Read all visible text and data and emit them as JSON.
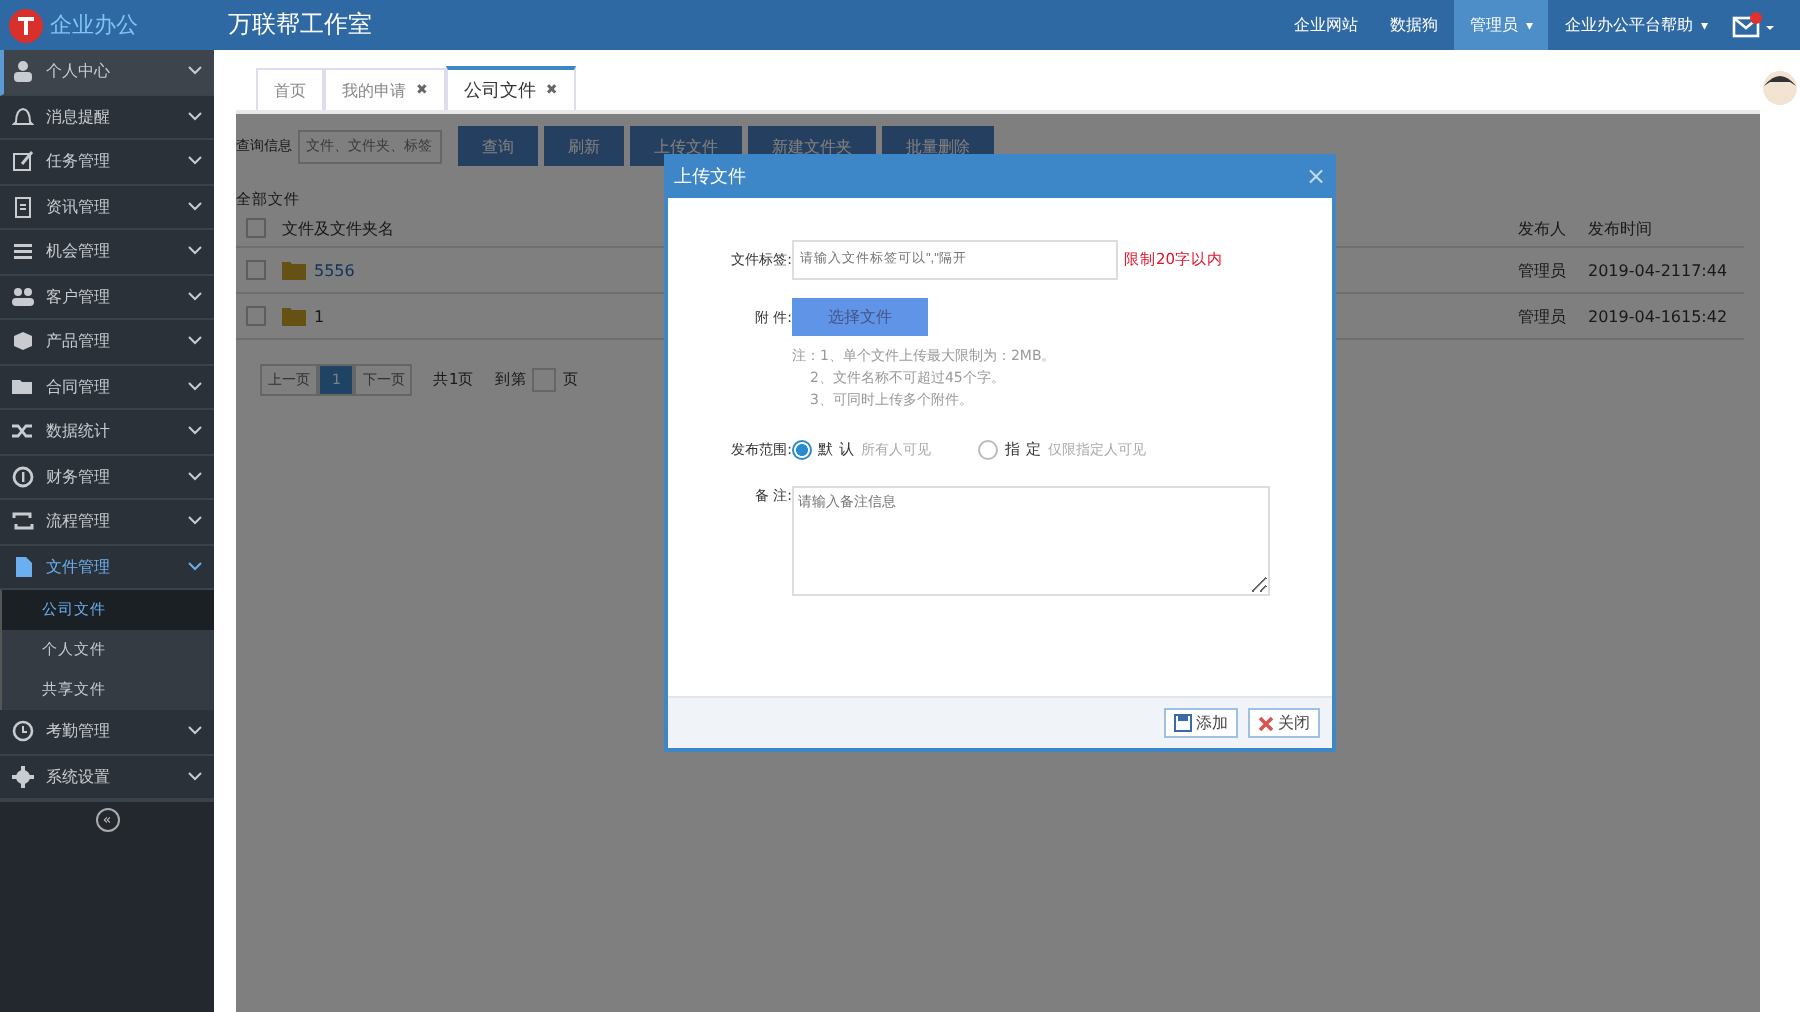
{
  "header": {
    "logo_text": "企业办公",
    "title": "万联帮工作室",
    "links": [
      {
        "label": "企业网站",
        "selected": false
      },
      {
        "label": "数据狗",
        "selected": false
      },
      {
        "label": "管理员",
        "selected": true,
        "caret": "▾"
      },
      {
        "label": "企业办公平台帮助",
        "selected": false,
        "caret": "▾"
      }
    ]
  },
  "sidebar": {
    "items": [
      {
        "label": "个人中心",
        "selected": true,
        "expanded": false
      },
      {
        "label": "消息提醒",
        "selected": false,
        "expanded": false
      },
      {
        "label": "任务管理",
        "selected": false,
        "expanded": false
      },
      {
        "label": "资讯管理",
        "selected": false,
        "expanded": false
      },
      {
        "label": "机会管理",
        "selected": false,
        "expanded": false
      },
      {
        "label": "客户管理",
        "selected": false,
        "expanded": false
      },
      {
        "label": "产品管理",
        "selected": false,
        "expanded": false
      },
      {
        "label": "合同管理",
        "selected": false,
        "expanded": false
      },
      {
        "label": "数据统计",
        "selected": false,
        "expanded": false
      },
      {
        "label": "财务管理",
        "selected": false,
        "expanded": false
      },
      {
        "label": "流程管理",
        "selected": false,
        "expanded": false
      },
      {
        "label": "文件管理",
        "selected": false,
        "expanded": true,
        "children": [
          {
            "label": "公司文件",
            "selected": true
          },
          {
            "label": "个人文件",
            "selected": false
          },
          {
            "label": "共享文件",
            "selected": false
          }
        ]
      },
      {
        "label": "考勤管理",
        "selected": false,
        "expanded": false
      },
      {
        "label": "系统设置",
        "selected": false,
        "expanded": false
      }
    ],
    "collapse": "«"
  },
  "tabs": [
    {
      "label": "首页",
      "selected": false,
      "closable": false
    },
    {
      "label": "我的申请",
      "selected": false,
      "closable": true
    },
    {
      "label": "公司文件",
      "selected": true,
      "closable": true
    }
  ],
  "close_glyph": "✖",
  "toolbar": {
    "query_label": "查询信息",
    "search": {
      "placeholder": "文件、文件夹、标签"
    },
    "buttons": [
      "查询",
      "刷新",
      "上传文件",
      "新建文件夹",
      "批量删除"
    ]
  },
  "section_title": "全部文件",
  "table": {
    "header_checked": false,
    "columns": [
      "文件及文件夹名",
      "发布人",
      "发布时间"
    ],
    "rows": [
      {
        "name": "5556",
        "publisher": "管理员",
        "time": "2019-04-2117:44",
        "checked": false,
        "link": true
      },
      {
        "name": "1",
        "publisher": "管理员",
        "time": "2019-04-1615:42",
        "checked": false,
        "link": false
      }
    ]
  },
  "pagination": {
    "prev": "上一页",
    "page": "1",
    "next": "下一页",
    "total": "共1页",
    "goto": "到第",
    "unit": "页"
  },
  "dialog": {
    "title": "上传文件",
    "close": "×",
    "tag_label": "文件标签:",
    "tag_placeholder": "请输入文件标签可以\",\"隔开",
    "tag_limit": "限制20字以内",
    "attach_label": "附 件:",
    "choose_button": "选择文件",
    "notes": [
      "注：1、单个文件上传最大限制为：2MB。",
      "2、文件名称不可超过45个字。",
      "3、可同时上传多个附件。"
    ],
    "scope_label": "发布范围:",
    "scope_options": [
      {
        "label": "默 认",
        "hint": "所有人可见",
        "selected": true
      },
      {
        "label": "指 定",
        "hint": "仅限指定人可见",
        "selected": false
      }
    ],
    "remark_label": "备 注:",
    "remark_placeholder": "请输入备注信息",
    "buttons": [
      {
        "label": "添加",
        "kind": "save"
      },
      {
        "label": "关闭",
        "kind": "close"
      }
    ]
  }
}
